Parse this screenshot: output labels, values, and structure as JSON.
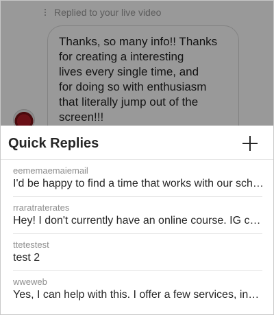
{
  "conversation": {
    "reply_context": "Replied to your live video",
    "message": "Thanks, so many info!! Thanks\nfor creating a interesting\nlives every single time, and\nfor doing so with enthusiasm\nthat literally jump out of the\nscreen!!!"
  },
  "quick_replies": {
    "title": "Quick Replies",
    "items": [
      {
        "shortcut": "eememaemaiemail",
        "message": "I'd be happy to find a time that works with our schedule"
      },
      {
        "shortcut": "rraratraterates",
        "message": "Hey! I don't currently have an online course. IG channel"
      },
      {
        "shortcut": "ttetestest",
        "message": "test 2"
      },
      {
        "shortcut": "wweweb",
        "message": "Yes, I can help with this. I offer a few services, including"
      }
    ]
  },
  "icons": {
    "add": "plus-icon",
    "more": "vertical-dots-icon",
    "avatar": "profile-avatar"
  },
  "colors": {
    "text_primary": "#262626",
    "text_secondary": "#8e8e8e",
    "divider": "#e6e6e6",
    "overlay": "rgba(0,0,0,0.40)"
  }
}
